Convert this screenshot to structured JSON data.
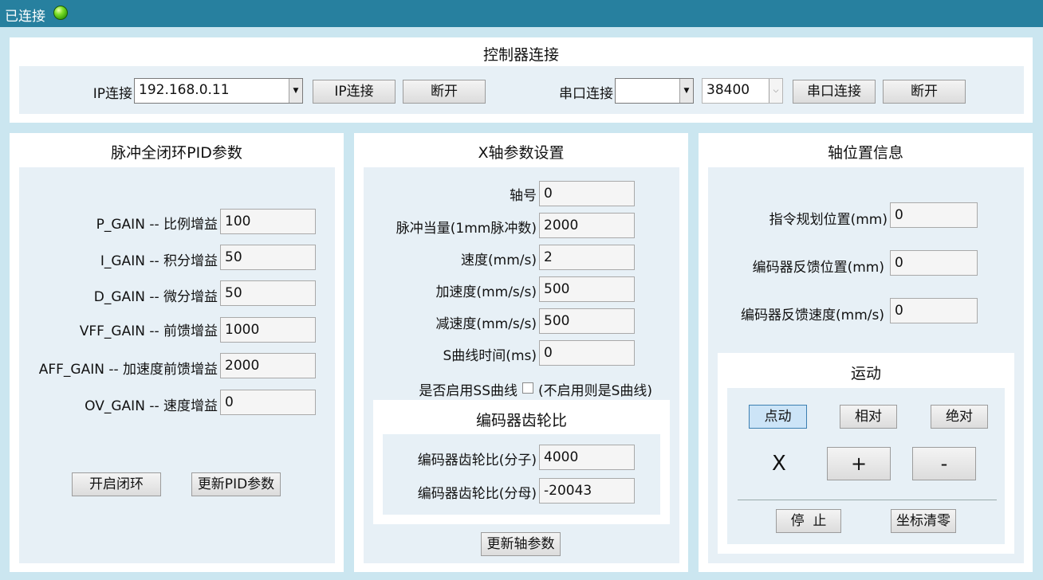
{
  "header": {
    "status": "已连接"
  },
  "connection": {
    "title": "控制器连接",
    "ip_label": "IP连接",
    "ip_value": "192.168.0.11",
    "ip_connect_button": "IP连接",
    "ip_disconnect_button": "断开",
    "serial_label": "串口连接",
    "serial_port_value": "",
    "baud_value": "38400",
    "serial_connect_button": "串口连接",
    "serial_disconnect_button": "断开"
  },
  "pid": {
    "title": "脉冲全闭环PID参数",
    "rows": [
      {
        "label": "P_GAIN -- 比例增益",
        "value": "100"
      },
      {
        "label": "I_GAIN -- 积分增益",
        "value": "50"
      },
      {
        "label": "D_GAIN -- 微分增益",
        "value": "50"
      },
      {
        "label": "VFF_GAIN -- 前馈增益",
        "value": "1000"
      },
      {
        "label": "AFF_GAIN -- 加速度前馈增益",
        "value": "2000"
      },
      {
        "label": "OV_GAIN -- 速度增益",
        "value": "0"
      }
    ],
    "enable_button": "开启闭环",
    "update_button": "更新PID参数"
  },
  "axis": {
    "title": "X轴参数设置",
    "rows": [
      {
        "label": "轴号",
        "value": "0"
      },
      {
        "label": "脉冲当量(1mm脉冲数)",
        "value": "2000"
      },
      {
        "label": "速度(mm/s)",
        "value": "2"
      },
      {
        "label": "加速度(mm/s/s)",
        "value": "500"
      },
      {
        "label": "减速度(mm/s/s)",
        "value": "500"
      },
      {
        "label": "S曲线时间(ms)",
        "value": "0"
      }
    ],
    "ss_label": "是否启用SS曲线",
    "ss_hint": "(不启用则是S曲线)",
    "gear_title": "编码器齿轮比",
    "gear_num_label": "编码器齿轮比(分子)",
    "gear_num_value": "4000",
    "gear_den_label": "编码器齿轮比(分母)",
    "gear_den_value": "-20043",
    "update_button": "更新轴参数"
  },
  "position": {
    "title": "轴位置信息",
    "rows": [
      {
        "label": "指令规划位置(mm)",
        "value": "0"
      },
      {
        "label": "编码器反馈位置(mm)",
        "value": "0"
      },
      {
        "label": "编码器反馈速度(mm/s)",
        "value": "0"
      }
    ],
    "motion": {
      "title": "运动",
      "jog_button": "点动",
      "relative_button": "相对",
      "absolute_button": "绝对",
      "axis_label": "X",
      "plus_button": "+",
      "minus_button": "-",
      "stop_button": "停  止",
      "zero_button": "坐标清零"
    }
  }
}
